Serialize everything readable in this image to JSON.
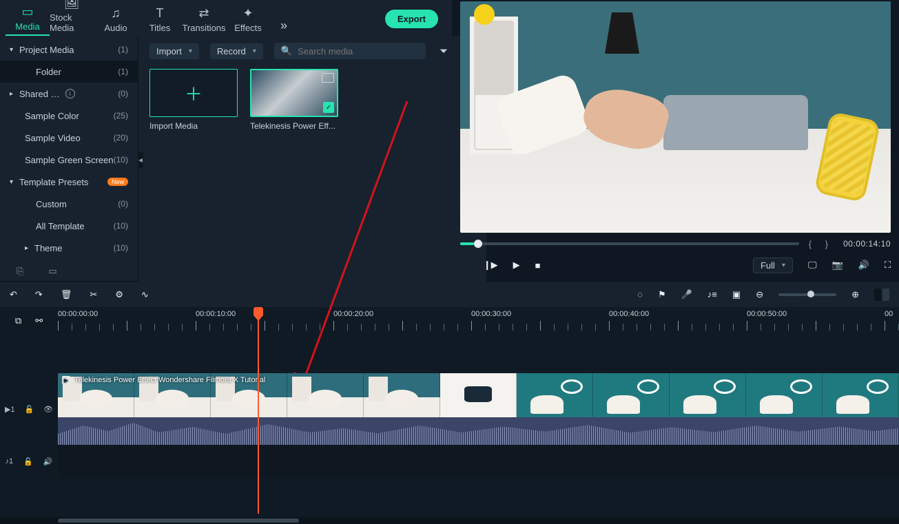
{
  "tabs": [
    {
      "label": "Media"
    },
    {
      "label": "Stock Media"
    },
    {
      "label": "Audio"
    },
    {
      "label": "Titles"
    },
    {
      "label": "Transitions"
    },
    {
      "label": "Effects"
    }
  ],
  "export_label": "Export",
  "sidebar": {
    "items": [
      {
        "label": "Project Media",
        "count": "(1)"
      },
      {
        "label": "Folder",
        "count": "(1)"
      },
      {
        "label": "Shared Media",
        "count": "(0)"
      },
      {
        "label": "Sample Color",
        "count": "(25)"
      },
      {
        "label": "Sample Video",
        "count": "(20)"
      },
      {
        "label": "Sample Green Screen",
        "count": "(10)"
      },
      {
        "label": "Template Presets"
      },
      {
        "label": "Custom",
        "count": "(0)"
      },
      {
        "label": "All Template",
        "count": "(10)"
      },
      {
        "label": "Theme",
        "count": "(10)"
      }
    ],
    "badge_new": "New"
  },
  "browser": {
    "import_label": "Import",
    "record_label": "Record",
    "search_placeholder": "Search media",
    "thumb_import": "Import Media",
    "thumb_video": "Telekinesis Power Eff..."
  },
  "preview": {
    "timecode": "00:00:14:10",
    "quality": "Full"
  },
  "ruler": {
    "t0": "00:00:00:00",
    "t1": "00:00:10:00",
    "t2": "00:00:20:00",
    "t3": "00:00:30:00",
    "t4": "00:00:40:00",
    "t5": "00:00:50:00",
    "t6": "00"
  },
  "tracks": {
    "video1": "1",
    "audio1": "1"
  },
  "clip": {
    "title": "Telekinesis Power Effect  Wondershare Filmora X Tutorial"
  },
  "scrub_percent": 4,
  "playhead_percent": 24
}
